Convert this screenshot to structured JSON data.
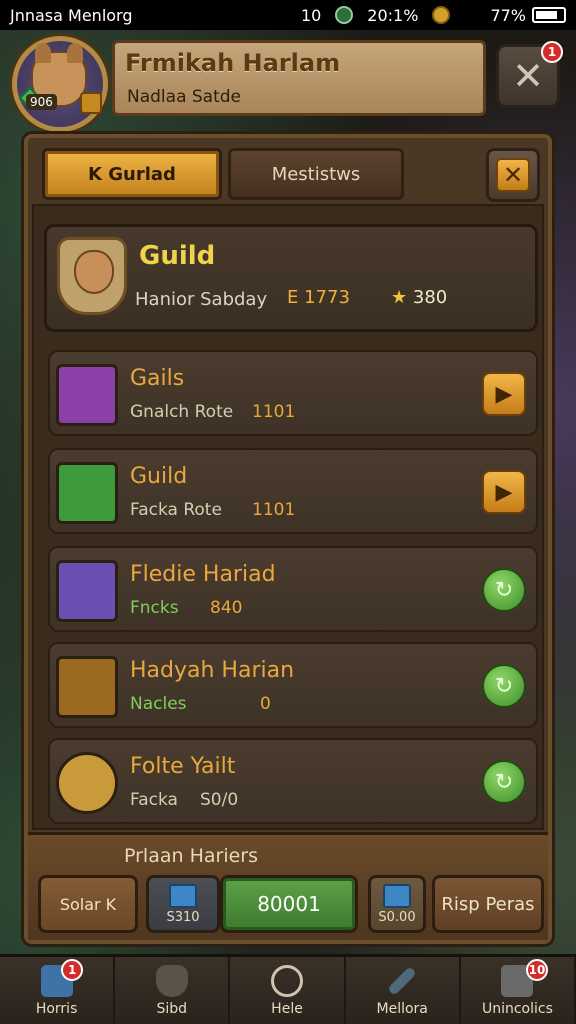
{
  "status_bar": {
    "carrier": "Jnnasa Menlorg",
    "signal": "10",
    "time": "20:1%",
    "battery": "77%"
  },
  "header": {
    "title": "Frmikah Harlam",
    "subtitle": "Nadlaa Satde",
    "level": "906",
    "tools_badge": "1"
  },
  "tabs": [
    {
      "label": "K Gurlad",
      "active": true
    },
    {
      "label": "Mestistws",
      "active": false
    }
  ],
  "guild": {
    "name": "Guild",
    "subtitle": "Hanior Sabday",
    "currency_1": "E 1773",
    "currency_2": "380"
  },
  "rows": [
    {
      "title": "Gails",
      "sub": "Gnalch  Rote",
      "value": "1101",
      "action": "play",
      "icon_color": "#8b3fa8"
    },
    {
      "title": "Guild",
      "sub": "Facka  Rote",
      "value": "1101",
      "action": "play",
      "icon_color": "#3e9b3c"
    },
    {
      "title": "Fledie Hariad",
      "sub": "Fncks",
      "value": "840",
      "action": "claim",
      "icon_color": "#6b4fb3"
    },
    {
      "title": "Hadyah Harian",
      "sub": "Nacles",
      "value": "0",
      "action": "claim",
      "icon_color": "#9a6a22"
    },
    {
      "title": "Folte Yailt",
      "sub": "Facka",
      "value": "S0/0",
      "action": "claim",
      "icon_color": "#c99a3a"
    }
  ],
  "footer": {
    "title": "Prlaan Hariers",
    "solar": "Solar K",
    "chest1": "S310",
    "main": "80001",
    "chest2": "S0.00",
    "risp": "Risp Peras"
  },
  "nav": [
    {
      "label": "Horris",
      "badge": "1",
      "icon": "book-icon"
    },
    {
      "label": "Sibd",
      "badge": "",
      "icon": "shield-icon"
    },
    {
      "label": "Hele",
      "badge": "",
      "icon": "power-icon"
    },
    {
      "label": "Mellora",
      "badge": "",
      "icon": "sword-icon"
    },
    {
      "label": "Unincolics",
      "badge": "10",
      "icon": "anvil-icon"
    }
  ]
}
